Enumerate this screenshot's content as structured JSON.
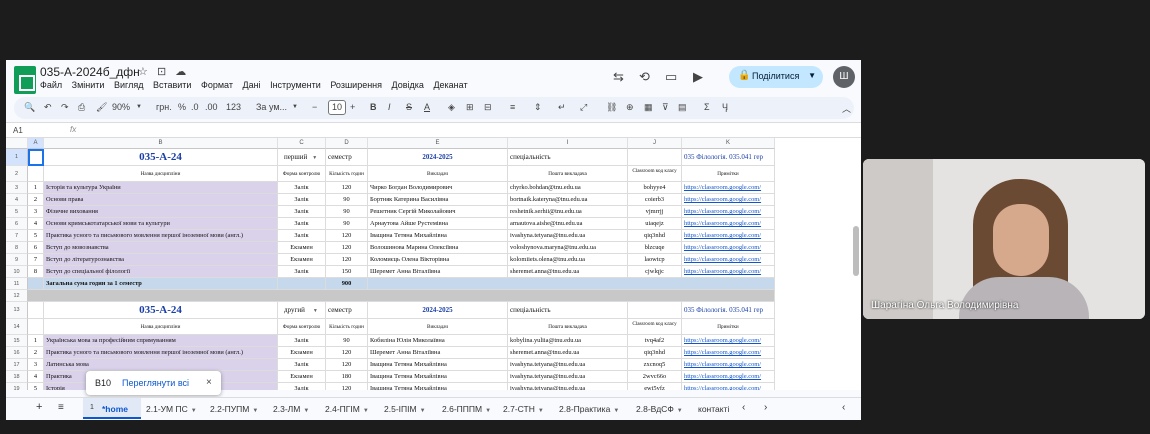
{
  "doc": {
    "title": "035-А-2024б_дфн",
    "menu": [
      "Файл",
      "Змінити",
      "Вигляд",
      "Вставити",
      "Формат",
      "Дані",
      "Інструменти",
      "Розширення",
      "Довідка",
      "Деканат"
    ],
    "share_label": "Поділитися",
    "avatar_letter": "Ш"
  },
  "toolbar": {
    "zoom": "90%",
    "currency": "грн.",
    "percent": "%",
    "dec_less": ".0",
    "dec_more": ".00",
    "num_format": "123",
    "font": "За ум...",
    "font_size": "10",
    "minus": "−",
    "plus": "+",
    "bold": "B",
    "italic": "I",
    "strike": "S",
    "text_color": "A",
    "sum": "Σ",
    "input_tools": "Ӌ"
  },
  "formula": {
    "cell_ref": "A1",
    "fx": "fx"
  },
  "grid": {
    "columns": [
      "A",
      "B",
      "C",
      "D",
      "E",
      "I",
      "J",
      "K"
    ],
    "row_numbers": [
      "1",
      "2",
      "3",
      "4",
      "5",
      "6",
      "7",
      "8",
      "9",
      "10",
      "11",
      "12",
      "13",
      "14",
      "15",
      "16",
      "17",
      "18",
      "19"
    ],
    "block1": {
      "group": "035-А-24",
      "semester": "перший",
      "sem_word": "семестр",
      "year": "2024-2025",
      "spec_label": "спеціальність",
      "spec_value": "035 Філологія. 035.041 гер"
    },
    "headers": [
      "Назва дисципліни",
      "Форма контролю",
      "Кількість годин",
      "Викладач",
      "Пошта викладача",
      "Classroom код класу",
      "Примітки"
    ],
    "rows1": [
      [
        "1",
        "Історія та культура України",
        "Залік",
        "120",
        "Чирко Богдан Володимирович",
        "chyrko.bohdan@tnu.edu.ua",
        "bohyye4",
        "https://classroom.google.com/"
      ],
      [
        "2",
        "Основи права",
        "Залік",
        "90",
        "Бортняк Катерина Василівна",
        "bortnaik.kateryna@tnu.edu.ua",
        "coierb3",
        "https://classroom.google.com/"
      ],
      [
        "3",
        "Фізичне виховання",
        "Залік",
        "90",
        "Решетник Сергій Миколайович",
        "reshetnik.serhii@tnu.edu.ua",
        "vjmrrjj",
        "https://classroom.google.com/"
      ],
      [
        "4",
        "Основи кримськотатарської мови та культури",
        "Залік",
        "90",
        "Арнаутова Айше Рустемівна",
        "arnautova.aishe@tnu.edu.ua",
        "uiaqejz",
        "https://classroom.google.com/"
      ],
      [
        "5",
        "Практика усного та письмового мовлення першої іноземної мови (англ.)",
        "Залік",
        "120",
        "Іващина Тетяна Михайлівна",
        "ivashyna.tetyana@tnu.edu.ua",
        "qiq3nhd",
        "https://classroom.google.com/"
      ],
      [
        "6",
        "Вступ до мовознавства",
        "Екзамен",
        "120",
        "Волошинова Марина Олексіївна",
        "voloshynova.maryna@tnu.edu.ua",
        "blzcuqe",
        "https://classroom.google.com/"
      ],
      [
        "7",
        "Вступ до літературознавства",
        "Екзамен",
        "120",
        "Коломиєць Олена Вікторівна",
        "kolomiiets.olena@tnu.edu.ua",
        "laowtcp",
        "https://classroom.google.com/"
      ],
      [
        "8",
        "Вступ до спеціальної філології",
        "Залік",
        "150",
        "Шеремет Анна Віталіївна",
        "sheremet.anna@tnu.edu.ua",
        "cjwlqjc",
        "https://classroom.google.com/"
      ]
    ],
    "sum1_label": "Загальна сума годин за 1 семестр",
    "sum1_value": "900",
    "block2": {
      "group": "035-А-24",
      "semester": "другий",
      "sem_word": "семестр",
      "year": "2024-2025",
      "spec_label": "спеціальність",
      "spec_value": "035 Філологія. 035.041 гер"
    },
    "rows2": [
      [
        "1",
        "Українська мова за професійним спрямуванням",
        "Залік",
        "90",
        "Кобиліна Юлія Миколаївна",
        "kobylina.yuliia@tnu.edu.ua",
        "tvq4af2",
        "https://classroom.google.com/"
      ],
      [
        "2",
        "Практика усного та письмового мовлення першої іноземної мови (англ.)",
        "Екзамен",
        "120",
        "Шеремет Анна Віталіївна",
        "sheremet.anna@tnu.edu.ua",
        "qiq3nhd",
        "https://classroom.google.com/"
      ],
      [
        "3",
        "Латинська мова",
        "Залік",
        "120",
        "Іващина Тетяна Михайлівна",
        "ivashyna.tetyana@tnu.edu.ua",
        "zxcnoq5",
        "https://classroom.google.com/"
      ],
      [
        "4",
        "Практика",
        "Екзамен",
        "180",
        "Іващина Тетяна Михайлівна",
        "ivashyna.tetyana@tnu.edu.ua",
        "2wvc66o",
        "https://classroom.google.com/"
      ],
      [
        "5",
        "Історія",
        "Залік",
        "120",
        "Іващина Тетяна Михайлівна",
        "ivashyna.tetyana@tnu.edu.ua",
        "ewi5vfz",
        "https://classroom.google.com/"
      ]
    ]
  },
  "popup": {
    "ref": "B10",
    "link": "Переглянути всі",
    "close": "×"
  },
  "tabs": {
    "active_num": "1",
    "active": "*home",
    "items": [
      "2.1-УМ ПС",
      "2.2-ПУПМ",
      "2.3-ЛМ",
      "2.4-ПГІМ",
      "2.5-ІПІМ",
      "2.6-ПППМ",
      "2.7-СТН",
      "2.8-Практика",
      "2.8-ВдСФ",
      "контакті"
    ]
  },
  "participant": {
    "name": "Шарагіна Ольга Володимирівна"
  }
}
